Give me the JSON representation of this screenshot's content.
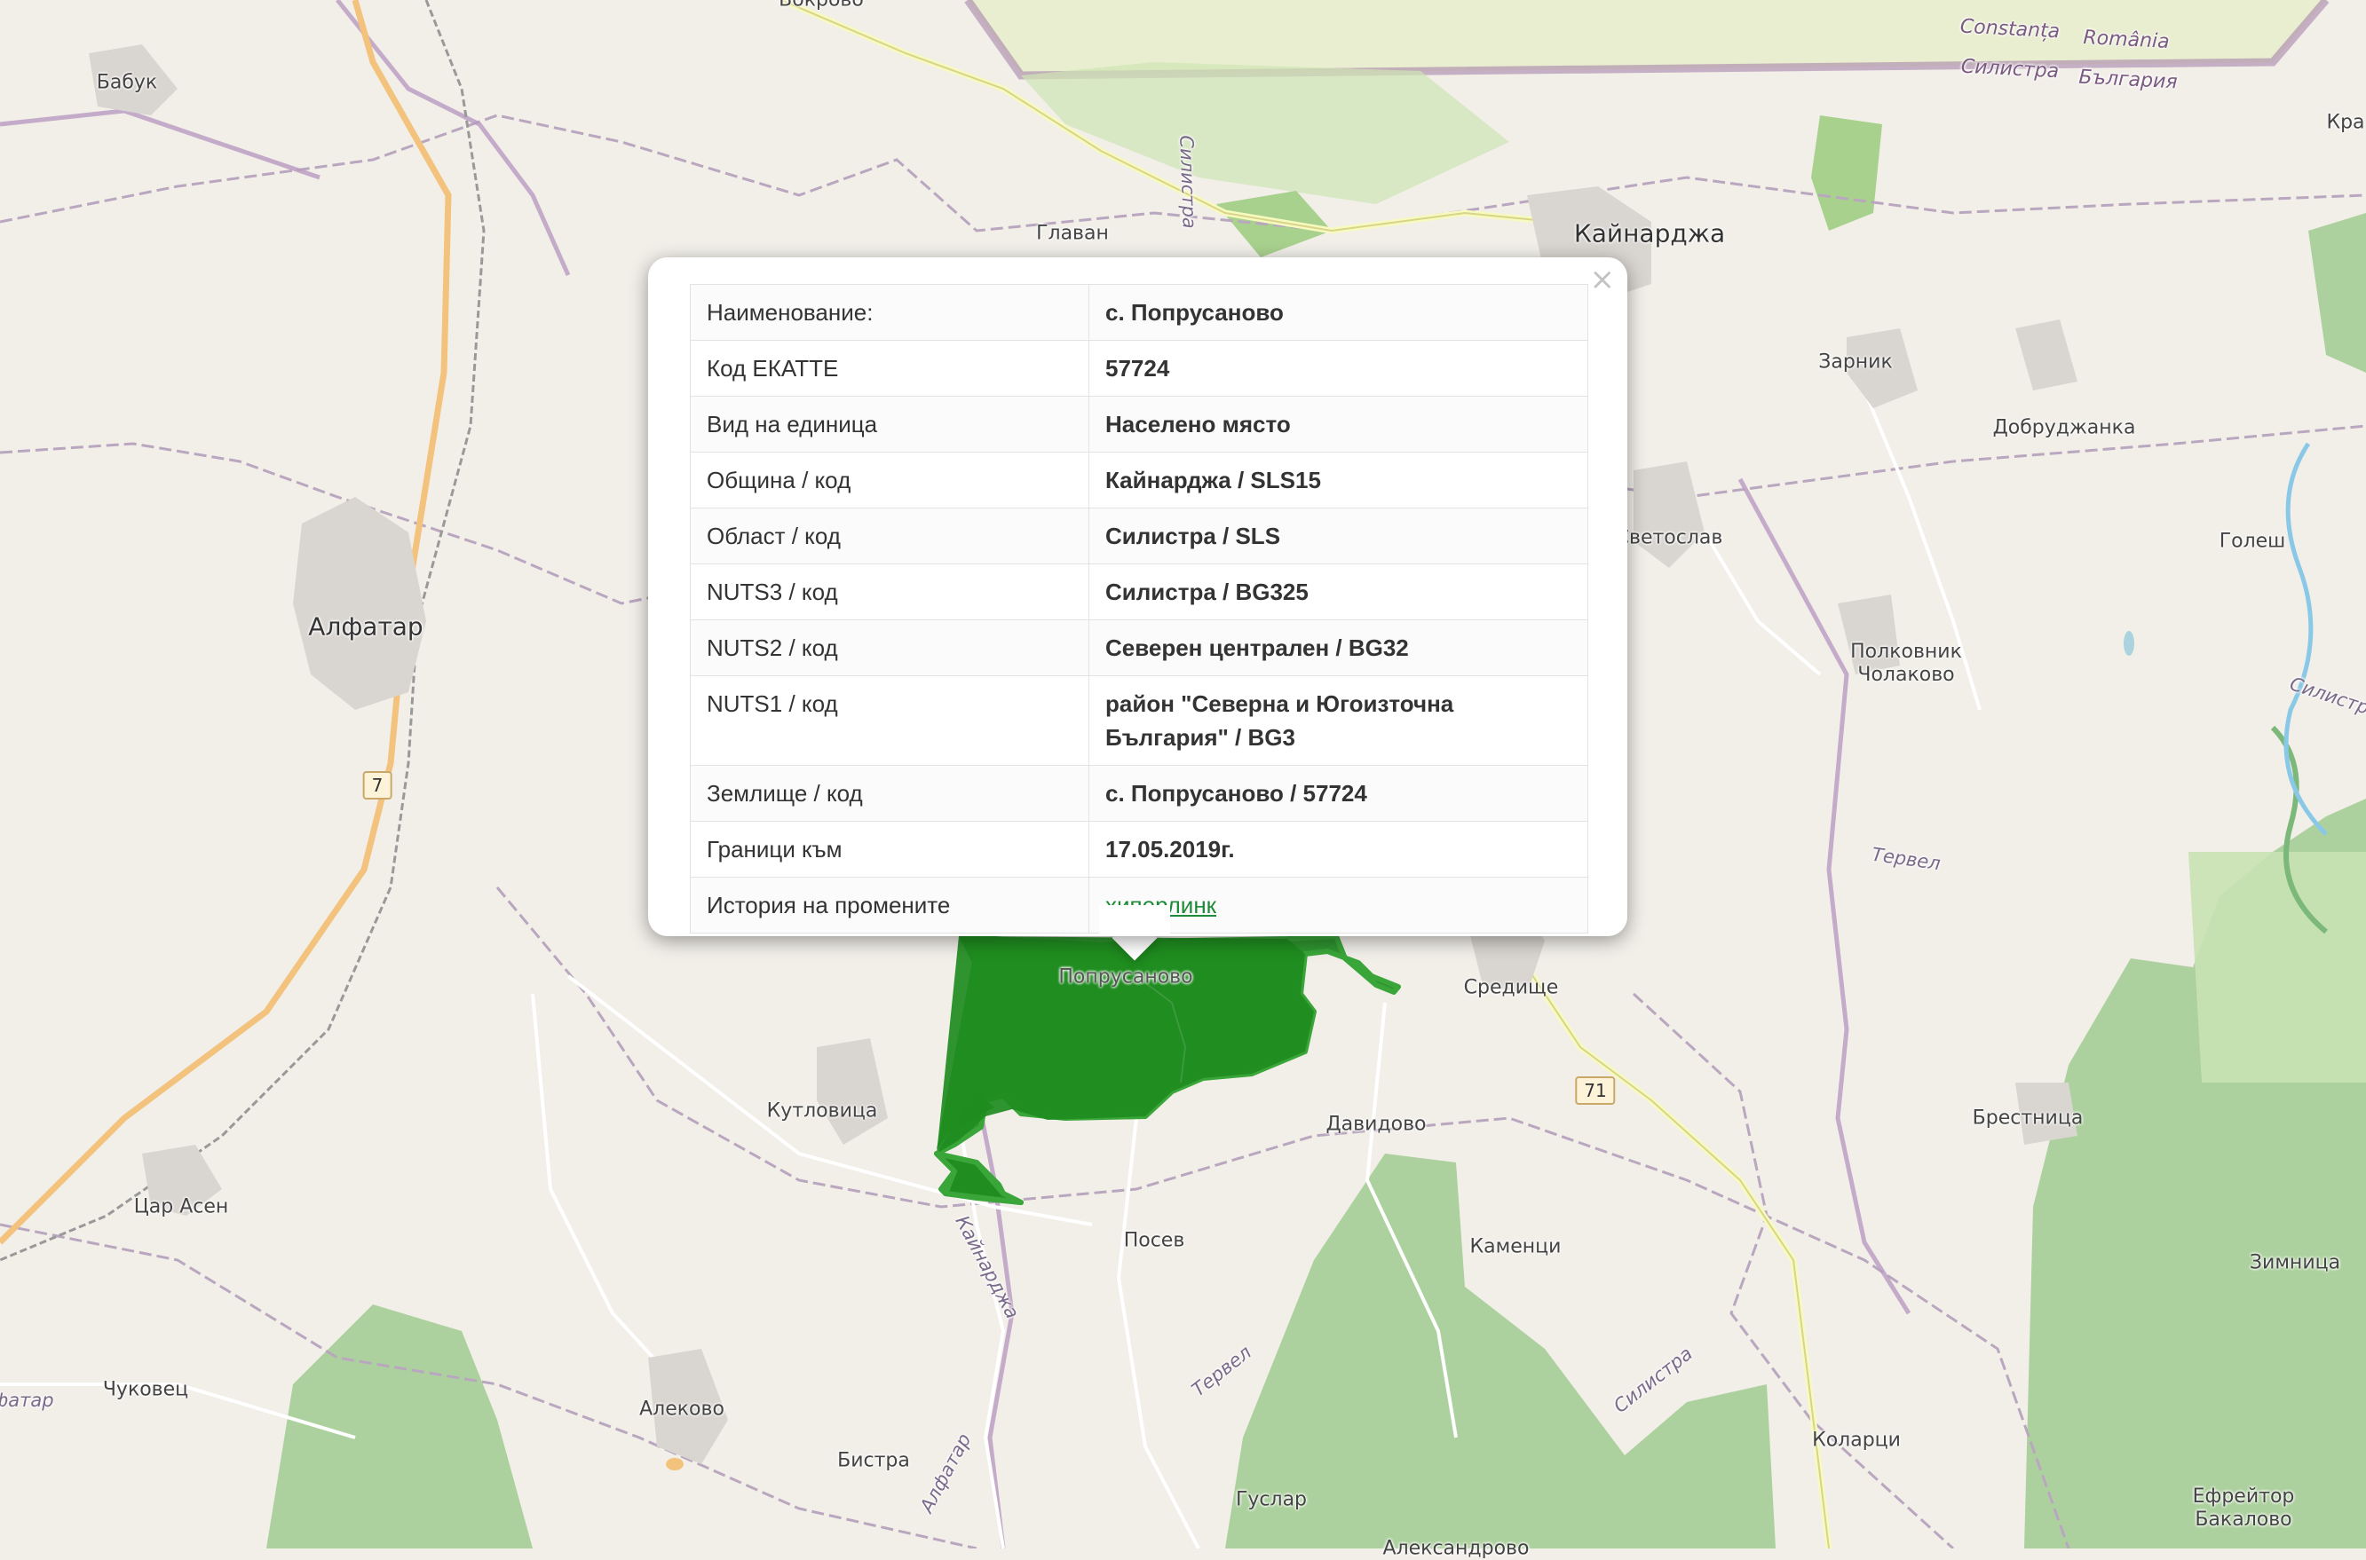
{
  "map": {
    "places": [
      {
        "name": "Бабук",
        "class": ""
      },
      {
        "name": "Алфатар",
        "class": "big"
      },
      {
        "name": "Кайнарджа",
        "class": "big"
      },
      {
        "name": "Главан",
        "class": ""
      },
      {
        "name": "Зарник",
        "class": ""
      },
      {
        "name": "Добруджанка",
        "class": ""
      },
      {
        "name": "Голеш",
        "class": ""
      },
      {
        "name": "Светослав",
        "class": ""
      },
      {
        "name": "Полковник\nЧолаково",
        "class": ""
      },
      {
        "name": "Попрусаново",
        "class": ""
      },
      {
        "name": "Средище",
        "class": ""
      },
      {
        "name": "Кутловица",
        "class": ""
      },
      {
        "name": "Давидово",
        "class": ""
      },
      {
        "name": "Брестница",
        "class": ""
      },
      {
        "name": "Цар Асен",
        "class": ""
      },
      {
        "name": "Посев",
        "class": ""
      },
      {
        "name": "Каменци",
        "class": ""
      },
      {
        "name": "Зимница",
        "class": ""
      },
      {
        "name": "Чуковец",
        "class": ""
      },
      {
        "name": "Алеково",
        "class": ""
      },
      {
        "name": "Бистра",
        "class": ""
      },
      {
        "name": "Гуслар",
        "class": ""
      },
      {
        "name": "Коларци",
        "class": ""
      },
      {
        "name": "Ефрейтор\nБакалово",
        "class": ""
      },
      {
        "name": "Кра",
        "class": ""
      },
      {
        "name": "Вокрово",
        "class": ""
      },
      {
        "name": "Александрово",
        "class": ""
      }
    ],
    "road_labels": [
      "Силистра",
      "Кайнарджа",
      "Алфатар",
      "Тервел",
      "Силистра",
      "Силистра",
      "Тервел",
      "Алфатар"
    ],
    "border_labels": [
      "Constanța",
      "România",
      "Силистра",
      "България"
    ],
    "shields": [
      "7",
      "71"
    ]
  },
  "popup": {
    "close_symbol": "×",
    "rows": [
      {
        "label": "Наименование:",
        "value": "с. Попрусаново"
      },
      {
        "label": "Код ЕКАТТЕ",
        "value": "57724"
      },
      {
        "label": "Вид на единица",
        "value": "Населено място"
      },
      {
        "label": "Община / код",
        "value": "Кайнарджа / SLS15"
      },
      {
        "label": "Област / код",
        "value": "Силистра / SLS"
      },
      {
        "label": "NUTS3 / код",
        "value": "Силистра / BG325"
      },
      {
        "label": "NUTS2 / код",
        "value": "Северен централен / BG32"
      },
      {
        "label": "NUTS1 / код",
        "value": "район \"Северна и Югоизточна България\" / BG3"
      },
      {
        "label": "Землище / код",
        "value": "с. Попрусаново / 57724"
      },
      {
        "label": "Граници към",
        "value": "17.05.2019г."
      },
      {
        "label": "История на промените",
        "value": "хиперлинк",
        "link": true
      }
    ]
  },
  "colors": {
    "polygon_fill": "#1e8c1e",
    "polygon_stroke": "#3aa63a",
    "forest": "#add19e",
    "land": "#f2efe9",
    "link": "#1e8b3a"
  }
}
